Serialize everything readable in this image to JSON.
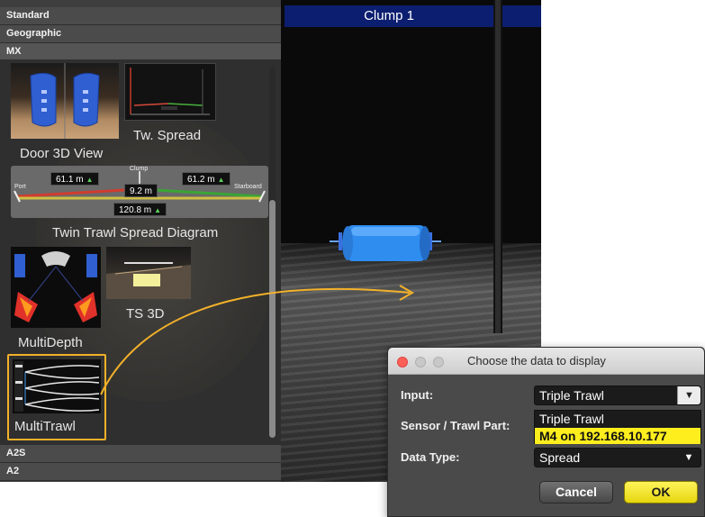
{
  "library": {
    "categories": {
      "standard": "Standard",
      "geographic": "Geographic",
      "mx": "MX",
      "a2s": "A2S",
      "a2": "A2"
    },
    "tiles": {
      "door3d": "Door 3D View",
      "tw_spread": "Tw. Spread",
      "twin_trawl": "Twin Trawl Spread Diagram",
      "multidepth": "MultiDepth",
      "ts3d": "TS 3D",
      "multitrawl": "MultiTrawl"
    },
    "spread_diagram": {
      "left_distance": "61.1 m",
      "right_distance": "61.2 m",
      "clump_height": "9.2 m",
      "total_spread": "120.8 m",
      "port": "Port",
      "clump": "Clump",
      "starboard": "Starboard"
    },
    "highlight_color": "#f2b12a"
  },
  "video": {
    "title": "Clump 1"
  },
  "dialog": {
    "title": "Choose the data to display",
    "input_label": "Input:",
    "input_value": "Triple Trawl",
    "sensor_label": "Sensor / Trawl Part:",
    "sensor_options": [
      "Triple Trawl",
      "M4 on 192.168.10.177"
    ],
    "datatype_label": "Data Type:",
    "datatype_value": "Spread",
    "cancel": "Cancel",
    "ok": "OK"
  }
}
